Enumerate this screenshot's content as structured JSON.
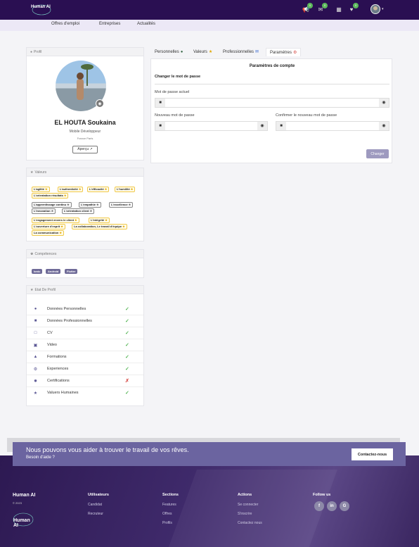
{
  "header": {
    "logo_text": "Human AI",
    "badges": [
      "0",
      "0",
      "0"
    ]
  },
  "nav": {
    "items": [
      "Offres d'emploi",
      "Entreprises",
      "Actualités"
    ]
  },
  "profile": {
    "section_label": "Profil",
    "name": "EL HOUTA Soukaina",
    "role": "Mobile Développeur",
    "location": "France Paris",
    "preview_label": "Aperçu"
  },
  "values": {
    "section_label": "Valeurs",
    "chips": [
      "L'agilité",
      "L'authenticité",
      "L'efficacité",
      "L'humilité",
      "L'orientation résultats",
      "L'apprentissage continu",
      "L'empathie",
      "L'excellence",
      "L'innovation",
      "L'orientation client",
      "L'engagement envers le client",
      "L'intégrité",
      "L'ouverture d'esprit",
      "La collaboration, Le travail d'équipe",
      "La communication"
    ]
  },
  "skills": {
    "section_label": "Compétences",
    "items": [
      "Ionic",
      "Android",
      "Flutter"
    ]
  },
  "status": {
    "section_label": "Etat De Profil",
    "rows": [
      {
        "label": "Données Personnelles"
      },
      {
        "label": "Données Professionnelles"
      },
      {
        "label": "CV"
      },
      {
        "label": "Video"
      },
      {
        "label": "Formations"
      },
      {
        "label": "Experiences"
      },
      {
        "label": "Certifications"
      },
      {
        "label": "Valuers Humaines"
      }
    ],
    "check_color": "#5cb85c",
    "cross_color": "#d9534f"
  },
  "tabs": [
    "Personnelles",
    "Valeurs",
    "Professionnelles",
    "Paramètres"
  ],
  "settings": {
    "title": "Paramètres de compte",
    "subtitle": "Changer le mot de passe",
    "current_label": "Mot de passe actuel",
    "new_label": "Nouveau mot de passe",
    "confirm_label": "Confirmer le nouveau mot de passe",
    "submit_label": "Changer"
  },
  "cta": {
    "title": "Nous pouvons vous aider à trouver le travail de vos rêves.",
    "subtitle": "Besoin d'aide ?",
    "button": "Contactez-nous"
  },
  "footer": {
    "brand": "Human AI",
    "copyright": "© 2023",
    "logo_text": "Human AI",
    "columns": [
      {
        "title": "Utilisateurs",
        "links": [
          "Candidat",
          "Recruteur"
        ]
      },
      {
        "title": "Sections",
        "links": [
          "Features",
          "Offres",
          "Profils"
        ]
      },
      {
        "title": "Actions",
        "links": [
          "Se connecter",
          "S'inscrire",
          "Contactez nous"
        ]
      }
    ],
    "follow_title": "Follow us"
  },
  "colors": {
    "topbar": "#2a0f52",
    "accent": "#6b64a0",
    "tag_border": "#f0c94a"
  }
}
